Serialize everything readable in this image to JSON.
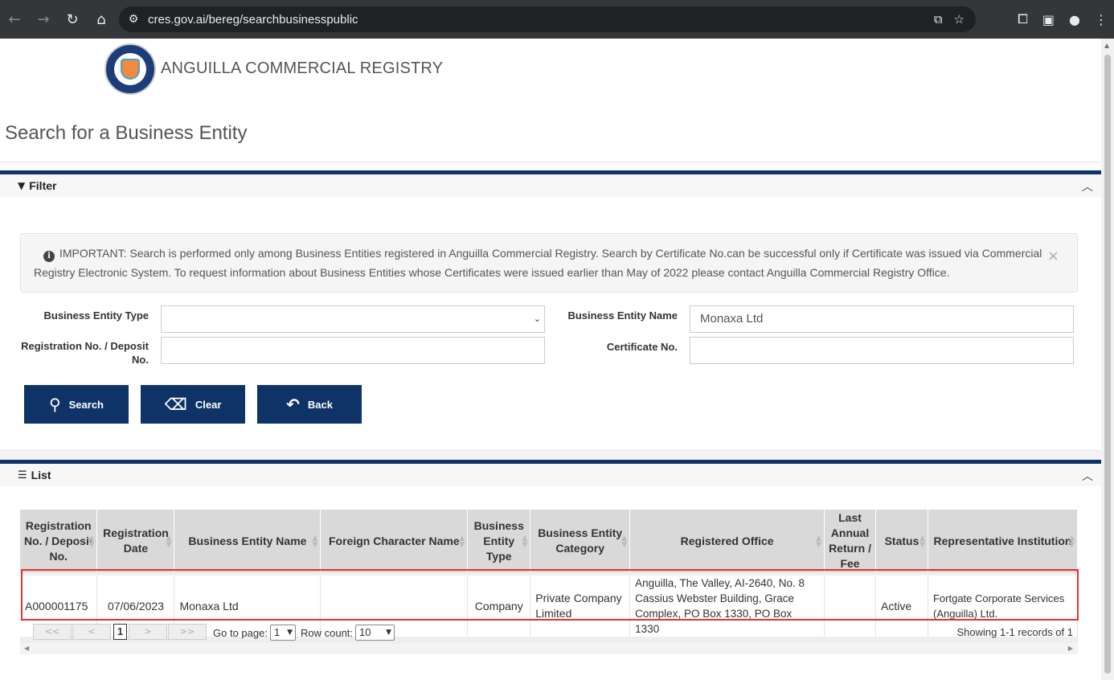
{
  "browser": {
    "url": "cres.gov.ai/bereg/searchbusinesspublic"
  },
  "header": {
    "brand": "ANGUILLA COMMERCIAL REGISTRY"
  },
  "page": {
    "title": "Search for a Business Entity"
  },
  "filter": {
    "title": "Filter",
    "alert": "IMPORTANT: Search is performed only among Business Entities registered in Anguilla Commercial Registry. Search by Certificate No.can be successful only if Certificate was issued via Commercial Registry Electronic System. To request information about Business Entities whose Certificates were issued earlier than May of 2022 please contact Anguilla Commercial Registry Office.",
    "labels": {
      "entity_type": "Business Entity Type",
      "entity_name": "Business Entity Name",
      "reg_no": "Registration No. / Deposit No.",
      "cert_no": "Certificate No."
    },
    "values": {
      "entity_type": "",
      "entity_name": "Monaxa Ltd",
      "reg_no": "",
      "cert_no": ""
    },
    "buttons": {
      "search": "Search",
      "clear": "Clear",
      "back": "Back"
    }
  },
  "list": {
    "title": "List",
    "columns": [
      "Registration No. / Deposit No.",
      "Registration Date",
      "Business Entity Name",
      "Foreign Character Name",
      "Business Entity Type",
      "Business Entity Category",
      "Registered Office",
      "Last Annual Return / Fee",
      "Status",
      "Representative Institution"
    ],
    "rows": [
      {
        "reg_no": "A000001175",
        "reg_date": "07/06/2023",
        "name": "Monaxa Ltd",
        "foreign_name": "",
        "type": "Company",
        "category": "Private Company Limited",
        "office": "Anguilla, The Valley, AI-2640, No. 8 Cassius Webster Building, Grace Complex, PO Box 1330, PO Box 1330",
        "last_return": "",
        "status": "Active",
        "rep": "Fortgate Corporate Services (Anguilla) Ltd."
      }
    ],
    "pager": {
      "first": "<<",
      "prev": "<",
      "current": "1",
      "next": ">",
      "last": ">>",
      "goto_label": "Go to page:",
      "goto_value": "1",
      "rowcount_label": "Row count:",
      "rowcount_value": "10",
      "showing": "Showing 1-1 records of 1"
    }
  }
}
